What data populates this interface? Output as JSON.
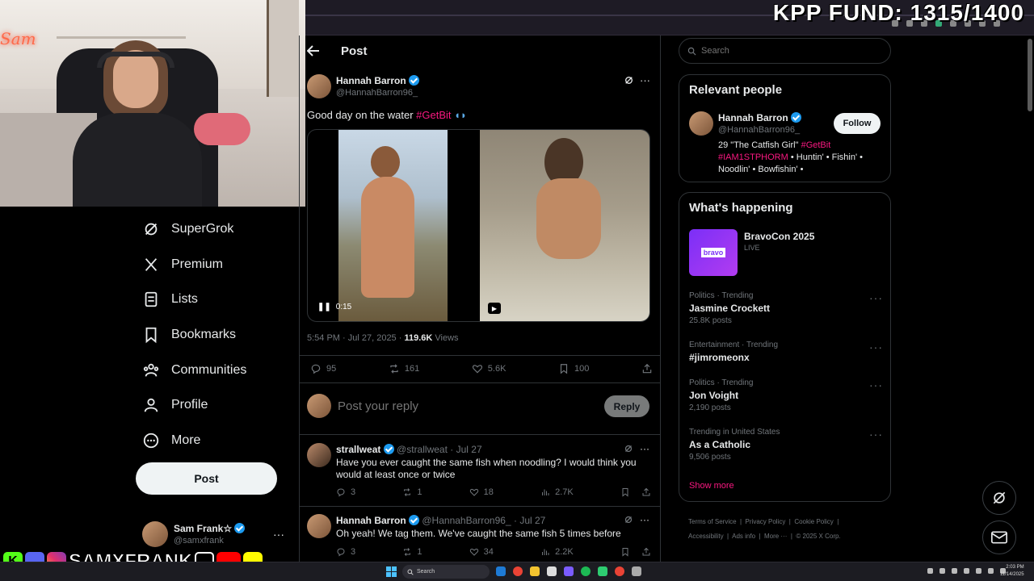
{
  "overlay": {
    "fund_text": "KPP FUND: 1315/1400",
    "social_name": "SAMXFRANK"
  },
  "nav": {
    "items": [
      {
        "label": "SuperGrok",
        "icon": "grok-icon"
      },
      {
        "label": "Premium",
        "icon": "x-logo-icon"
      },
      {
        "label": "Lists",
        "icon": "list-icon"
      },
      {
        "label": "Bookmarks",
        "icon": "bookmark-icon"
      },
      {
        "label": "Communities",
        "icon": "communities-icon"
      },
      {
        "label": "Profile",
        "icon": "profile-icon"
      },
      {
        "label": "More",
        "icon": "more-circle-icon"
      }
    ],
    "post_button": "Post",
    "account": {
      "name": "Sam Frank☆",
      "handle": "@samxfrank"
    }
  },
  "header": {
    "title": "Post"
  },
  "tweet": {
    "author": "Hannah Barron",
    "handle": "@HannahBarron96_",
    "text": "Good day on the water",
    "hashtag": "#GetBit",
    "video_time": "0:15",
    "timestamp": "5:54 PM · Jul 27, 2025 ·",
    "views_count": "119.6K",
    "views_label": "Views",
    "replies": "95",
    "reposts": "161",
    "likes": "5.6K",
    "bookmarks": "100"
  },
  "reply_box": {
    "placeholder": "Post your reply",
    "button": "Reply"
  },
  "replies": [
    {
      "name": "strallweat",
      "handle": "@strallweat",
      "date": "· Jul 27",
      "text": "Have you ever caught the same fish when noodling? I would think you would at least once or twice",
      "replies": "3",
      "reposts": "1",
      "likes": "18",
      "views": "2.7K"
    },
    {
      "name": "Hannah Barron",
      "handle": "@HannahBarron96_",
      "date": "· Jul 27",
      "text": "Oh yeah! We tag them. We've caught the same fish 5 times before",
      "replies": "3",
      "reposts": "1",
      "likes": "34",
      "views": "2.2K"
    }
  ],
  "search": {
    "placeholder": "Search"
  },
  "relevant": {
    "title": "Relevant people",
    "name": "Hannah Barron",
    "handle": "@HannahBarron96_",
    "follow": "Follow",
    "bio_prefix": "29 \"The Catfish Girl\"",
    "bio_tag1": "#GetBit",
    "bio_tag2": "#IAM1STPHORM",
    "bio_rest_1": "• Huntin' • Fishin' •",
    "bio_rest_2": "Noodlin' • Bowfishin' •"
  },
  "happening": {
    "title": "What's happening",
    "live_event": {
      "name": "BravoCon 2025",
      "status": "LIVE",
      "logo_text": "bravo"
    },
    "trends": [
      {
        "meta": "Politics · Trending",
        "name": "Jasmine Crockett",
        "posts": "25.8K posts"
      },
      {
        "meta": "Entertainment · Trending",
        "name": "#jimromeonx",
        "posts": ""
      },
      {
        "meta": "Politics · Trending",
        "name": "Jon Voight",
        "posts": "2,190 posts"
      },
      {
        "meta": "Trending in United States",
        "name": "As a Catholic",
        "posts": "9,506 posts"
      }
    ],
    "show_more": "Show more"
  },
  "footer": {
    "links": [
      "Terms of Service",
      "Privacy Policy",
      "Cookie Policy",
      "Accessibility",
      "Ads info",
      "More ···",
      "© 2025 X Corp."
    ]
  },
  "taskbar": {
    "search": "Search",
    "time": "2:03 PM",
    "date": "11/14/2025"
  },
  "colors": {
    "accent": "#1d9bf0",
    "hashtag": "#f91880",
    "background": "#000000"
  }
}
